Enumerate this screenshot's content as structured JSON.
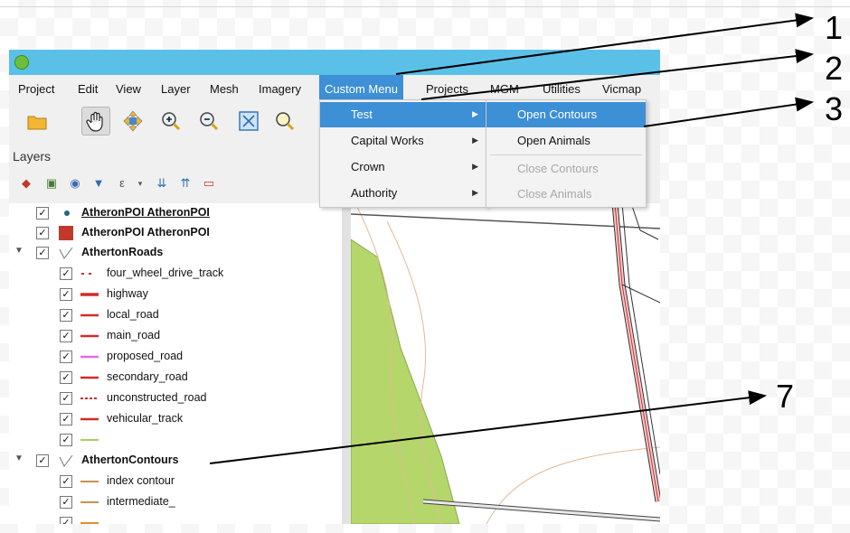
{
  "menubar": {
    "items": [
      "Project",
      "Edit",
      "View",
      "Layer",
      "Mesh",
      "Imagery",
      "Custom Menu",
      "Projects",
      "MGM",
      "Utilities",
      "Vicmap"
    ]
  },
  "custom_menu": {
    "items": [
      {
        "label": "Test",
        "has_submenu": true,
        "highlighted": true
      },
      {
        "label": "Capital Works",
        "has_submenu": true
      },
      {
        "label": "Crown",
        "has_submenu": true
      },
      {
        "label": "Authority",
        "has_submenu": true
      }
    ],
    "submenu_arrow": "▶"
  },
  "test_submenu": {
    "items": [
      {
        "label": "Open Contours",
        "highlighted": true,
        "enabled": true
      },
      {
        "label": "Open Animals",
        "enabled": true
      },
      {
        "label": "Close Contours",
        "enabled": false
      },
      {
        "label": "Close Animals",
        "enabled": false
      }
    ]
  },
  "layers_panel": {
    "title": "Layers",
    "rows": [
      {
        "label": "AtheronPOI AtheronPOI",
        "checked": true,
        "symbol": "dot-icon",
        "bold": true,
        "underline": true
      },
      {
        "label": "AtheronPOI AtheronPOI",
        "checked": true,
        "symbol": "fill-square-icon",
        "bold": true
      },
      {
        "label": "AthertonRoads",
        "checked": true,
        "symbol": "line-layer-icon",
        "bold": true,
        "expanded": true
      },
      {
        "label": "four_wheel_drive_track",
        "checked": true,
        "symbol": "dotted-red-line",
        "indent": true
      },
      {
        "label": "highway",
        "checked": true,
        "symbol": "thick-red-line",
        "indent": true
      },
      {
        "label": "local_road",
        "checked": true,
        "symbol": "red-line",
        "indent": true
      },
      {
        "label": "main_road",
        "checked": true,
        "symbol": "red-line",
        "indent": true
      },
      {
        "label": "proposed_road",
        "checked": true,
        "symbol": "pink-line",
        "indent": true
      },
      {
        "label": "secondary_road",
        "checked": true,
        "symbol": "red-line",
        "indent": true
      },
      {
        "label": "unconstructed_road",
        "checked": true,
        "symbol": "dashed-red-line",
        "indent": true
      },
      {
        "label": "vehicular_track",
        "checked": true,
        "symbol": "red-line",
        "indent": true
      },
      {
        "label": "",
        "checked": true,
        "symbol": "green-line",
        "indent": true
      },
      {
        "label": "AthertonContours",
        "checked": true,
        "symbol": "line-layer-icon",
        "bold": true,
        "expanded": true
      },
      {
        "label": "index contour",
        "checked": true,
        "symbol": "brown-line",
        "indent": true
      },
      {
        "label": "intermediate_",
        "checked": true,
        "symbol": "brown-line",
        "indent": true
      },
      {
        "label": "",
        "checked": true,
        "symbol": "orange-line",
        "indent": true
      }
    ]
  },
  "callouts": [
    "1",
    "2",
    "3",
    "7"
  ],
  "colors": {
    "titlebar": "#5bc0e8",
    "highlight": "#3d8fd6",
    "road_red": "#d42b2b",
    "proposed_pink": "#e070e0",
    "contour_brown": "#c89050",
    "vegetation_green": "#b5d66b"
  },
  "glyphs": {
    "check": "✓",
    "expand": "▼"
  }
}
